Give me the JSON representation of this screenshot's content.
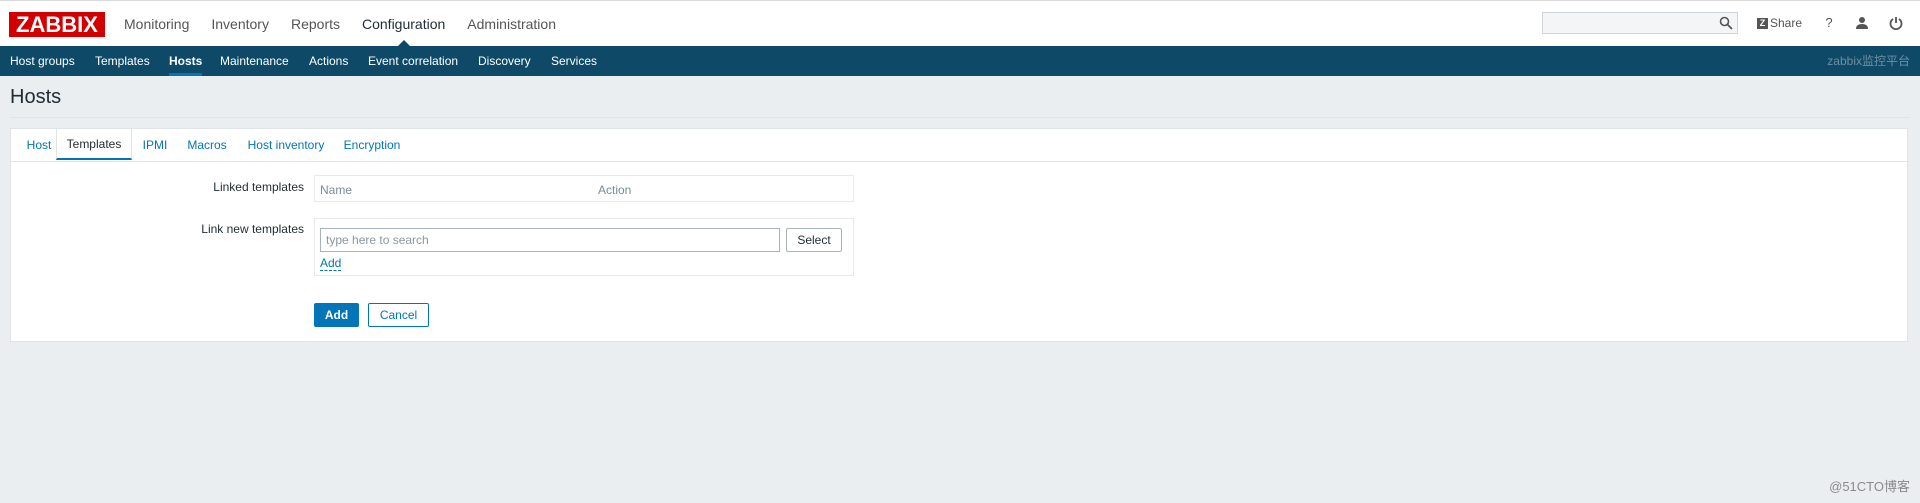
{
  "header": {
    "logo": "ZABBIX",
    "menu": [
      {
        "label": "Monitoring"
      },
      {
        "label": "Inventory"
      },
      {
        "label": "Reports"
      },
      {
        "label": "Configuration",
        "active": true
      },
      {
        "label": "Administration"
      }
    ],
    "search_placeholder": "",
    "share_label": "Share",
    "help_label": "?"
  },
  "subnav": {
    "items": [
      {
        "label": "Host groups"
      },
      {
        "label": "Templates"
      },
      {
        "label": "Hosts",
        "active": true
      },
      {
        "label": "Maintenance"
      },
      {
        "label": "Actions"
      },
      {
        "label": "Event correlation"
      },
      {
        "label": "Discovery"
      },
      {
        "label": "Services"
      }
    ],
    "server_name": "zabbix监控平台"
  },
  "page": {
    "title": "Hosts"
  },
  "tabs": [
    {
      "label": "Host"
    },
    {
      "label": "Templates",
      "active": true
    },
    {
      "label": "IPMI"
    },
    {
      "label": "Macros"
    },
    {
      "label": "Host inventory"
    },
    {
      "label": "Encryption"
    }
  ],
  "form": {
    "linked_templates_label": "Linked templates",
    "linked_columns": [
      "Name",
      "Action"
    ],
    "link_new_label": "Link new templates",
    "search_placeholder": "type here to search",
    "select_label": "Select",
    "add_link_label": "Add",
    "add_button": "Add",
    "cancel_button": "Cancel"
  },
  "watermark": "@51CTO博客",
  "colors": {
    "brand": "#d40000",
    "nav": "#0e4a68",
    "accent": "#0275b8"
  }
}
